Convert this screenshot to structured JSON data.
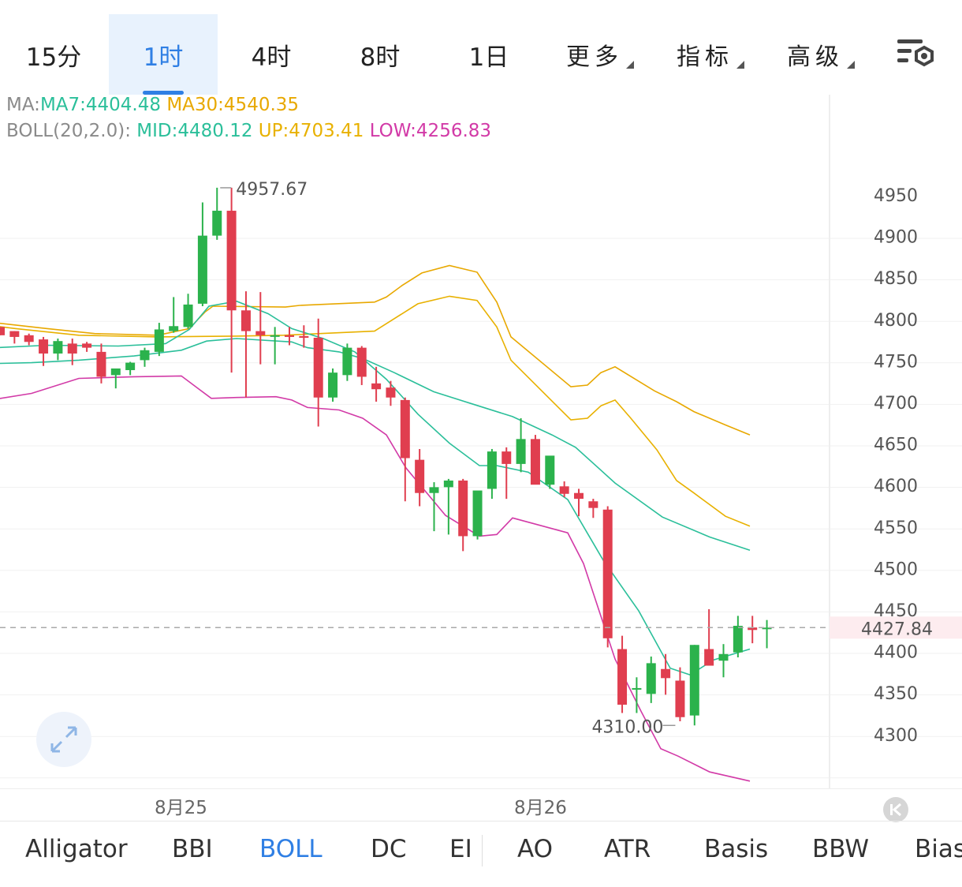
{
  "tabs": [
    {
      "label": "15分"
    },
    {
      "label": "1时"
    },
    {
      "label": "4时"
    },
    {
      "label": "8时"
    },
    {
      "label": "1日"
    }
  ],
  "dropdowns": [
    {
      "label": "更多"
    },
    {
      "label": "指标"
    },
    {
      "label": "高级"
    }
  ],
  "active_tab": "1时",
  "settings_icon": "chart-settings-icon",
  "legend": {
    "ma_prefix": "MA:",
    "ma7": "MA7:4404.48",
    "ma30": "MA30:4540.35",
    "boll_prefix": "BOLL(20,2.0):",
    "mid": "MID:4480.12",
    "up": "UP:4703.41",
    "low": "LOW:4256.83"
  },
  "colors": {
    "up_candle": "#2bb24c",
    "down_candle": "#e03e4f",
    "ma7": "#2bbf9a",
    "ma30": "#e8a800",
    "boll_mid": "#2bbf9a",
    "boll_up": "#e8b100",
    "boll_low": "#d23aa7",
    "accent": "#2f7fe4",
    "current_price": "#e03e4f"
  },
  "chart_data": {
    "type": "candlestick",
    "interval": "1时",
    "y_ticks": [
      4950,
      4900,
      4850,
      4800,
      4750,
      4700,
      4650,
      4600,
      4550,
      4500,
      4450,
      4400,
      4350,
      4300
    ],
    "current_price": "4427.84",
    "current_price_value": 4427.84,
    "high_label": "4957.67",
    "high_value": 4957.67,
    "low_label": "4310.00",
    "low_value": 4310.0,
    "date_labels": [
      "8月25",
      "8月26"
    ],
    "candles": [
      [
        4790,
        4790,
        4780,
        4780
      ],
      [
        4785,
        4785,
        4770,
        4778
      ],
      [
        4780,
        4782,
        4768,
        4772
      ],
      [
        4775,
        4778,
        4743,
        4758
      ],
      [
        4758,
        4776,
        4750,
        4773
      ],
      [
        4770,
        4776,
        4744,
        4758
      ],
      [
        4770,
        4772,
        4760,
        4765
      ],
      [
        4760,
        4770,
        4722,
        4730
      ],
      [
        4732,
        4738,
        4716,
        4740
      ],
      [
        4738,
        4748,
        4732,
        4747
      ],
      [
        4750,
        4765,
        4742,
        4762
      ],
      [
        4760,
        4795,
        4755,
        4787
      ],
      [
        4785,
        4826,
        4783,
        4791
      ],
      [
        4790,
        4830,
        4788,
        4817
      ],
      [
        4818,
        4940,
        4815,
        4900
      ],
      [
        4900,
        4957.67,
        4895,
        4930
      ],
      [
        4930,
        4957.67,
        4735,
        4810
      ],
      [
        4810,
        4833,
        4705,
        4785
      ],
      [
        4785,
        4832,
        4745,
        4780
      ],
      [
        4780,
        4790,
        4745,
        4780
      ],
      [
        4780,
        4790,
        4768,
        4778
      ],
      [
        4779,
        4792,
        4765,
        4777
      ],
      [
        4777,
        4800,
        4670,
        4705
      ],
      [
        4705,
        4740,
        4700,
        4735
      ],
      [
        4732,
        4770,
        4725,
        4765
      ],
      [
        4765,
        4767,
        4720,
        4730
      ],
      [
        4722,
        4742,
        4700,
        4715
      ],
      [
        4717,
        4725,
        4695,
        4705
      ],
      [
        4702,
        4705,
        4580,
        4632
      ],
      [
        4630,
        4643,
        4574,
        4590
      ],
      [
        4590,
        4603,
        4544,
        4597
      ],
      [
        4597,
        4607,
        4540,
        4605
      ],
      [
        4605,
        4607,
        4520,
        4538
      ],
      [
        4538,
        4578,
        4534,
        4593
      ],
      [
        4595,
        4643,
        4583,
        4640
      ],
      [
        4640,
        4645,
        4583,
        4625
      ],
      [
        4625,
        4680,
        4615,
        4655
      ],
      [
        4655,
        4660,
        4605,
        4600
      ],
      [
        4600,
        4632,
        4595,
        4635
      ],
      [
        4598,
        4604,
        4585,
        4589
      ],
      [
        4590,
        4595,
        4562,
        4583
      ],
      [
        4580,
        4583,
        4560,
        4572
      ],
      [
        4570,
        4574,
        4404,
        4415
      ],
      [
        4402,
        4418,
        4325,
        4335
      ],
      [
        4355,
        4368,
        4325,
        4355
      ],
      [
        4348,
        4393,
        4337,
        4385
      ],
      [
        4378,
        4396,
        4347,
        4367
      ],
      [
        4364,
        4380,
        4315,
        4320
      ],
      [
        4322,
        4407,
        4310,
        4407
      ],
      [
        4402,
        4450,
        4385,
        4382
      ],
      [
        4388,
        4408,
        4368,
        4396
      ],
      [
        4398,
        4442,
        4392,
        4430
      ],
      [
        4428,
        4442,
        4409,
        4425
      ],
      [
        4427,
        4437,
        4403,
        4427.84
      ]
    ],
    "boll_up": [
      [
        -5,
        4791
      ],
      [
        20,
        4788
      ],
      [
        100,
        4780
      ],
      [
        200,
        4778
      ],
      [
        300,
        4779
      ],
      [
        360,
        4780
      ],
      [
        475,
        4785
      ],
      [
        500,
        4800
      ],
      [
        530,
        4818
      ],
      [
        570,
        4827
      ],
      [
        605,
        4822
      ],
      [
        630,
        4790
      ],
      [
        648,
        4750
      ],
      [
        724,
        4678
      ],
      [
        745,
        4680
      ],
      [
        762,
        4695
      ],
      [
        780,
        4702
      ],
      [
        800,
        4680
      ],
      [
        833,
        4642
      ],
      [
        858,
        4605
      ],
      [
        880,
        4590
      ],
      [
        920,
        4562
      ],
      [
        951,
        4550
      ]
    ],
    "boll_mid": [
      [
        -5,
        4746
      ],
      [
        40,
        4747
      ],
      [
        100,
        4750
      ],
      [
        170,
        4755
      ],
      [
        230,
        4762
      ],
      [
        262,
        4773
      ],
      [
        300,
        4776
      ],
      [
        370,
        4772
      ],
      [
        390,
        4765
      ],
      [
        430,
        4760
      ],
      [
        460,
        4752
      ],
      [
        500,
        4735
      ],
      [
        550,
        4712
      ],
      [
        600,
        4697
      ],
      [
        650,
        4682
      ],
      [
        700,
        4660
      ],
      [
        730,
        4645
      ],
      [
        780,
        4602
      ],
      [
        840,
        4561
      ],
      [
        900,
        4537
      ],
      [
        951,
        4521
      ]
    ],
    "boll_low": [
      [
        -5,
        4703
      ],
      [
        40,
        4710
      ],
      [
        100,
        4728
      ],
      [
        170,
        4730
      ],
      [
        230,
        4731
      ],
      [
        268,
        4704
      ],
      [
        300,
        4705
      ],
      [
        350,
        4706
      ],
      [
        370,
        4702
      ],
      [
        390,
        4693
      ],
      [
        430,
        4690
      ],
      [
        460,
        4680
      ],
      [
        490,
        4660
      ],
      [
        515,
        4620
      ],
      [
        565,
        4563
      ],
      [
        608,
        4538
      ],
      [
        630,
        4540
      ],
      [
        650,
        4560
      ],
      [
        720,
        4542
      ],
      [
        740,
        4505
      ],
      [
        780,
        4390
      ],
      [
        813,
        4327
      ],
      [
        838,
        4282
      ],
      [
        860,
        4273
      ],
      [
        900,
        4254
      ],
      [
        951,
        4243
      ]
    ],
    "ma7": [
      [
        -5,
        4765
      ],
      [
        60,
        4768
      ],
      [
        150,
        4767
      ],
      [
        210,
        4770
      ],
      [
        240,
        4787
      ],
      [
        265,
        4815
      ],
      [
        300,
        4821
      ],
      [
        340,
        4806
      ],
      [
        370,
        4788
      ],
      [
        410,
        4776
      ],
      [
        450,
        4760
      ],
      [
        490,
        4727
      ],
      [
        530,
        4685
      ],
      [
        570,
        4650
      ],
      [
        608,
        4623
      ],
      [
        630,
        4623
      ],
      [
        670,
        4615
      ],
      [
        720,
        4582
      ],
      [
        765,
        4509
      ],
      [
        810,
        4448
      ],
      [
        850,
        4379
      ],
      [
        875,
        4371
      ],
      [
        905,
        4389
      ],
      [
        951,
        4402
      ]
    ],
    "ma30": [
      [
        -5,
        4795
      ],
      [
        60,
        4788
      ],
      [
        120,
        4782
      ],
      [
        200,
        4780
      ],
      [
        240,
        4788
      ],
      [
        260,
        4808
      ],
      [
        270,
        4815
      ],
      [
        362,
        4814
      ],
      [
        380,
        4816
      ],
      [
        475,
        4820
      ],
      [
        490,
        4826
      ],
      [
        510,
        4840
      ],
      [
        535,
        4855
      ],
      [
        570,
        4864
      ],
      [
        605,
        4856
      ],
      [
        630,
        4820
      ],
      [
        648,
        4778
      ],
      [
        724,
        4718
      ],
      [
        745,
        4720
      ],
      [
        762,
        4735
      ],
      [
        780,
        4742
      ],
      [
        830,
        4713
      ],
      [
        858,
        4700
      ],
      [
        880,
        4688
      ],
      [
        920,
        4672
      ],
      [
        951,
        4660
      ]
    ]
  },
  "dates": [
    "8月25",
    "8月26"
  ],
  "bottom_indicators": [
    {
      "label": "Alligator"
    },
    {
      "label": "BBI"
    },
    {
      "label": "BOLL"
    },
    {
      "label": "DC"
    },
    {
      "label": "EI"
    },
    {
      "label": "AO"
    },
    {
      "label": "ATR"
    },
    {
      "label": "Basis"
    },
    {
      "label": "BBW"
    },
    {
      "label": "Bias"
    }
  ],
  "expand_icon": "expand-icon",
  "back_icon": "scroll-to-latest-icon"
}
